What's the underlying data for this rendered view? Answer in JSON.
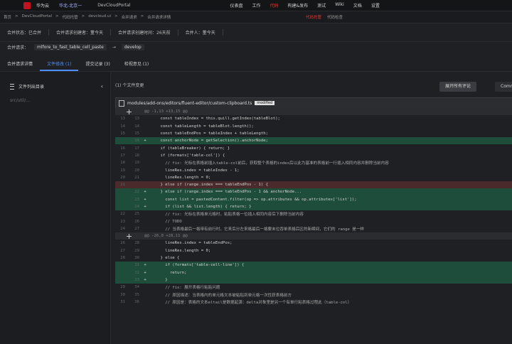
{
  "topbar": {
    "brand": "华为云",
    "org": "华北-北京一",
    "project": "DevCloudPortal",
    "nav": [
      "仪表盘",
      "工作",
      "代码",
      "构建&发布",
      "测试",
      "Wiki",
      "文档",
      "设置"
    ],
    "active_nav_index": 2
  },
  "breadcrumb": {
    "items": [
      "首页",
      "DevCloudPortal",
      "代码托管",
      "devcloud.ui",
      "合并请求",
      "合并请求详情"
    ],
    "center": [
      "代码托管",
      "代码检查"
    ]
  },
  "meta": {
    "status": "合并状态：已合并",
    "creator": "合并请求创建者：董今天",
    "created": "合并请求创建时间：26天前",
    "merger": "合并人：董今天"
  },
  "merge": {
    "label": "合并请求：",
    "source": "mlfore_to_fast_table_cell_paste",
    "arrow": "→",
    "target": "develop"
  },
  "tabs": [
    {
      "label": "合并请求详情",
      "active": false
    },
    {
      "label": "文件修改 (1)",
      "active": true
    },
    {
      "label": "提交记录 (3)",
      "active": false
    },
    {
      "label": "检视意见 (1)",
      "active": false
    }
  ],
  "sidebar": {
    "title": "文件列出目录",
    "file": "src/util/..."
  },
  "main": {
    "files_count": "(1) 个文件变更",
    "btn_collapse": "展开所有评论",
    "btn_other": "Comm",
    "file_path": "modules/add-ons/editors/fluent-editor/custom-clipboard.ts",
    "file_tag": "modified"
  },
  "code_lines": [
    {
      "type": "hunk",
      "l1": "",
      "l2": "",
      "mk": "",
      "text": "@@ -1,13 +13,15 @@"
    },
    {
      "type": "ctx",
      "l1": "13",
      "l2": "13",
      "mk": "",
      "text": "    const tableIndex = this.quill.getIndex(tableBlot);"
    },
    {
      "type": "ctx",
      "l1": "14",
      "l2": "14",
      "mk": "",
      "text": "    const tableLength = tableBlot.length();"
    },
    {
      "type": "ctx",
      "l1": "15",
      "l2": "15",
      "mk": "",
      "text": "    const tableEndPos = tableIndex + tableLength;"
    },
    {
      "type": "add",
      "l1": "",
      "l2": "16",
      "mk": "+",
      "text": "    const anchorNode = getSelection().anchorNode;"
    },
    {
      "type": "ctx",
      "l1": "16",
      "l2": "17",
      "mk": "",
      "text": "    if (tableBreaker) { return; }"
    },
    {
      "type": "ctx",
      "l1": "17",
      "l2": "18",
      "mk": "",
      "text": "    if (formats['table-col']) {"
    },
    {
      "type": "cmt",
      "l1": "18",
      "l2": "19",
      "mk": "",
      "text": "      // fix: 光标在表格前插入table-col前后，获取整个表格的index后以此为基准的表格前一行插入相同内容并删除当前内容"
    },
    {
      "type": "ctx",
      "l1": "19",
      "l2": "20",
      "mk": "",
      "text": "      lineRes.index = tableIndex - 1;"
    },
    {
      "type": "ctx",
      "l1": "20",
      "l2": "21",
      "mk": "",
      "text": "      lineRes.length = 0;"
    },
    {
      "type": "del",
      "l1": "21",
      "l2": "",
      "mk": "",
      "text": "    } else if (range.index === tableEndPos - 1) {"
    },
    {
      "type": "add",
      "l1": "",
      "l2": "22",
      "mk": "+",
      "text": "    } else if (range.index === tableEndPos - 1 && anchorNode..."
    },
    {
      "type": "add",
      "l1": "",
      "l2": "23",
      "mk": "+",
      "text": "      const list = pastedContent.filter(op => op.attributes && op.attributes['list']);"
    },
    {
      "type": "add",
      "l1": "",
      "l2": "24",
      "mk": "+",
      "text": "      if (list && list.length) { return; }"
    },
    {
      "type": "cmt",
      "l1": "22",
      "l2": "25",
      "mk": "",
      "text": "      // fix: 光标在表格单元格时，粘贴表格一位插入相同内容后下删除当前内容"
    },
    {
      "type": "cmt",
      "l1": "23",
      "l2": "26",
      "mk": "",
      "text": "      // TODO"
    },
    {
      "type": "cmt",
      "l1": "24",
      "l2": "27",
      "mk": "",
      "text": "      // 当表格最后一格带有前行时，它来后分左来格最后一格要末位吞单表格后区的新瞬间，它们的 range 是一样"
    },
    {
      "type": "hunk",
      "l1": "",
      "l2": "",
      "mk": "",
      "text": "@@ -26,8 +28,11 @@"
    },
    {
      "type": "ctx",
      "l1": "26",
      "l2": "28",
      "mk": "",
      "text": "      lineRes.index = tableEndPos;"
    },
    {
      "type": "ctx",
      "l1": "27",
      "l2": "29",
      "mk": "",
      "text": "      lineRes.length = 0;"
    },
    {
      "type": "ctx",
      "l1": "28",
      "l2": "30",
      "mk": "",
      "text": "    } else {"
    },
    {
      "type": "add",
      "l1": "",
      "l2": "31",
      "mk": "+",
      "text": "      if (formats['table-cell-line']) {"
    },
    {
      "type": "add",
      "l1": "",
      "l2": "32",
      "mk": "+",
      "text": "        return;"
    },
    {
      "type": "add",
      "l1": "",
      "l2": "33",
      "mk": "+",
      "text": "      }"
    },
    {
      "type": "cmt",
      "l1": "29",
      "l2": "34",
      "mk": "",
      "text": "      // fix: 展开表格行粘贴问题"
    },
    {
      "type": "cmt",
      "l1": "30",
      "l2": "35",
      "mk": "",
      "text": "      // 原因描述：当表格内的单元格文本被粘贴到单元格一次性获表格前方"
    },
    {
      "type": "cmt",
      "l1": "31",
      "l2": "36",
      "mk": "",
      "text": "      // 原因是：表格的文本eltail是数据起源：delta对象里是另一个有单行粘表格过程此（table-col）"
    }
  ]
}
